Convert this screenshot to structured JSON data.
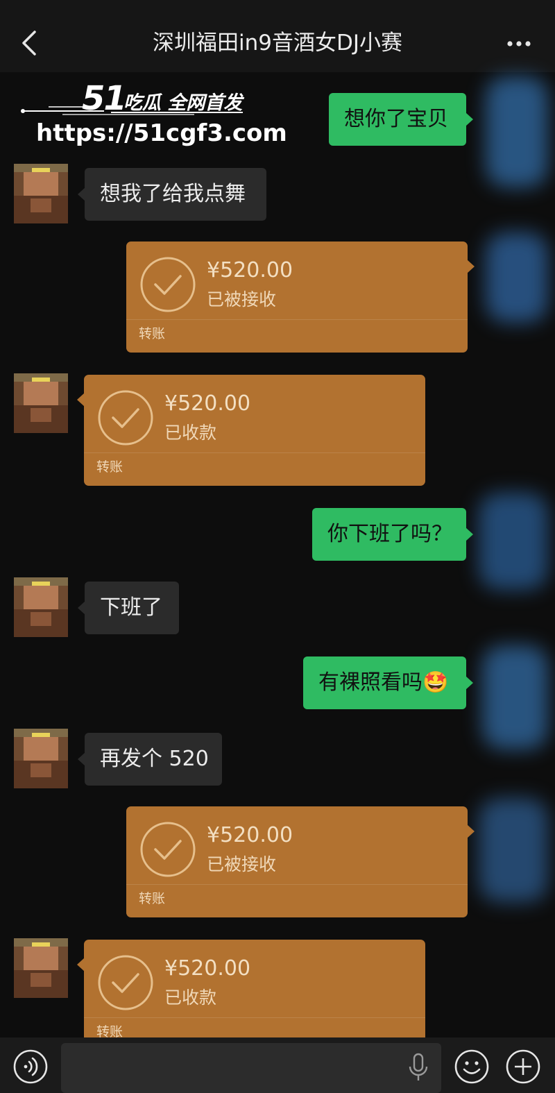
{
  "header": {
    "title": "深圳福田in9音酒女DJ小赛"
  },
  "watermark": {
    "logo": "51",
    "tagline": "吃瓜 全网首发",
    "url": "https://51cgf3.com"
  },
  "messages": {
    "m1": {
      "text": "想你了宝贝"
    },
    "m2": {
      "text": "想我了给我点舞"
    },
    "t1": {
      "amount": "¥520.00",
      "status": "已被接收",
      "label": "转账"
    },
    "t2": {
      "amount": "¥520.00",
      "status": "已收款",
      "label": "转账"
    },
    "m3": {
      "text": "你下班了吗？"
    },
    "m4": {
      "text": "下班了"
    },
    "m5": {
      "text": "有裸照看吗",
      "emoji": "🤩"
    },
    "m6": {
      "text": "再发个 520"
    },
    "t3": {
      "amount": "¥520.00",
      "status": "已被接收",
      "label": "转账"
    },
    "t4": {
      "amount": "¥520.00",
      "status": "已收款",
      "label": "转账"
    }
  },
  "colors": {
    "sent_bubble": "#2fbb62",
    "received_bubble": "#2b2b2b",
    "transfer_bubble": "#b27230",
    "background": "#0d0d0d"
  }
}
